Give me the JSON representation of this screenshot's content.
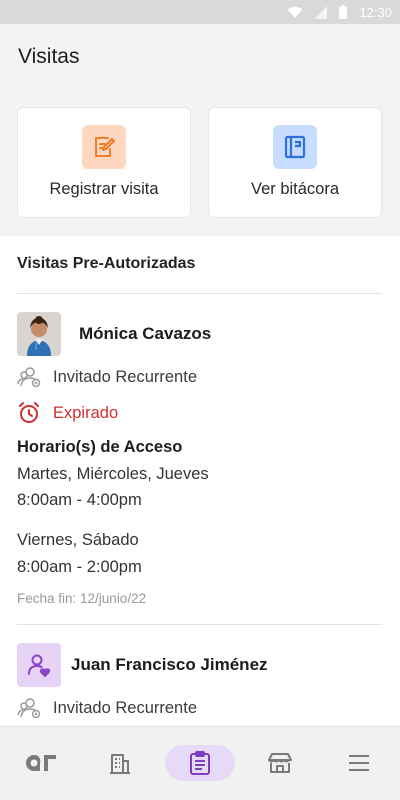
{
  "status_bar": {
    "time": "12:30"
  },
  "header": {
    "title": "Visitas"
  },
  "actions": [
    {
      "label": "Registrar visita",
      "icon": "edit-document-icon",
      "color": "#ffd6bf"
    },
    {
      "label": "Ver bitácora",
      "icon": "logbook-icon",
      "color": "#c7dcff"
    }
  ],
  "section": {
    "title": "Visitas Pre-Autorizadas"
  },
  "visits": [
    {
      "name": "Mónica Cavazos",
      "type": "Invitado Recurrente",
      "status": "Expirado",
      "schedule_title": "Horario(s) de Acceso",
      "schedules": [
        {
          "days": "Martes, Miércoles, Jueves",
          "hours": "8:00am - 4:00pm"
        },
        {
          "days": "Viernes, Sábado",
          "hours": "8:00am - 2:00pm"
        }
      ],
      "end_date": "Fecha fin: 12/junio/22"
    },
    {
      "name": "Juan Francisco Jiménez",
      "type": "Invitado Recurrente"
    }
  ],
  "bottom_nav": [
    {
      "name": "qr",
      "icon": "qr-icon"
    },
    {
      "name": "building",
      "icon": "building-icon"
    },
    {
      "name": "visits",
      "icon": "clipboard-icon",
      "active": true
    },
    {
      "name": "store",
      "icon": "store-icon"
    },
    {
      "name": "menu",
      "icon": "menu-icon"
    }
  ],
  "colors": {
    "accent": "#7b3fbf",
    "expired": "#d32f2f",
    "active_nav_bg": "#e6daf6"
  }
}
